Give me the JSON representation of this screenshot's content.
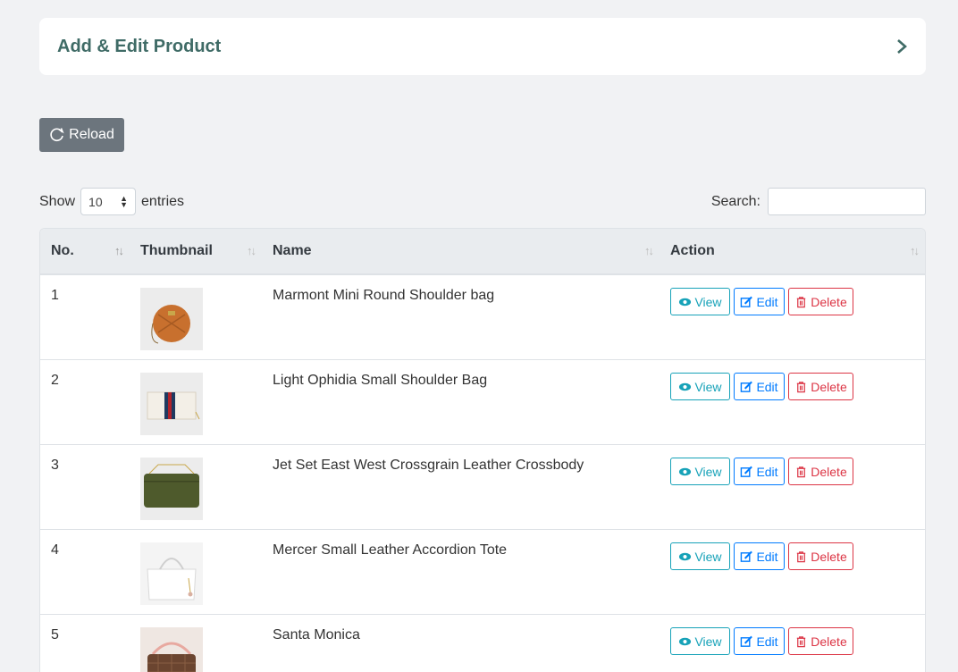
{
  "collapse": {
    "title": "Add & Edit Product",
    "icon": "chevron-right-icon"
  },
  "toolbar": {
    "reload_label": "Reload"
  },
  "length": {
    "show_label": "Show",
    "value": "10",
    "entries_label": "entries"
  },
  "search": {
    "label": "Search:",
    "value": ""
  },
  "table": {
    "headers": [
      "No.",
      "Thumbnail",
      "Name",
      "Action"
    ],
    "action_labels": {
      "view": "View",
      "edit": "Edit",
      "delete": "Delete"
    },
    "rows": [
      {
        "no": "1",
        "name": "Marmont Mini Round Shoulder bag"
      },
      {
        "no": "2",
        "name": "Light Ophidia Small Shoulder Bag"
      },
      {
        "no": "3",
        "name": "Jet Set East West Crossgrain Leather Crossbody"
      },
      {
        "no": "4",
        "name": "Mercer Small Leather Accordion Tote"
      },
      {
        "no": "5",
        "name": "Santa Monica"
      }
    ]
  },
  "colors": {
    "page_bg": "#f1f2f4",
    "title": "#3f6b66",
    "view": "#17a2b8",
    "edit": "#007bff",
    "delete": "#dc3545",
    "reload_bg": "#6c757d"
  }
}
